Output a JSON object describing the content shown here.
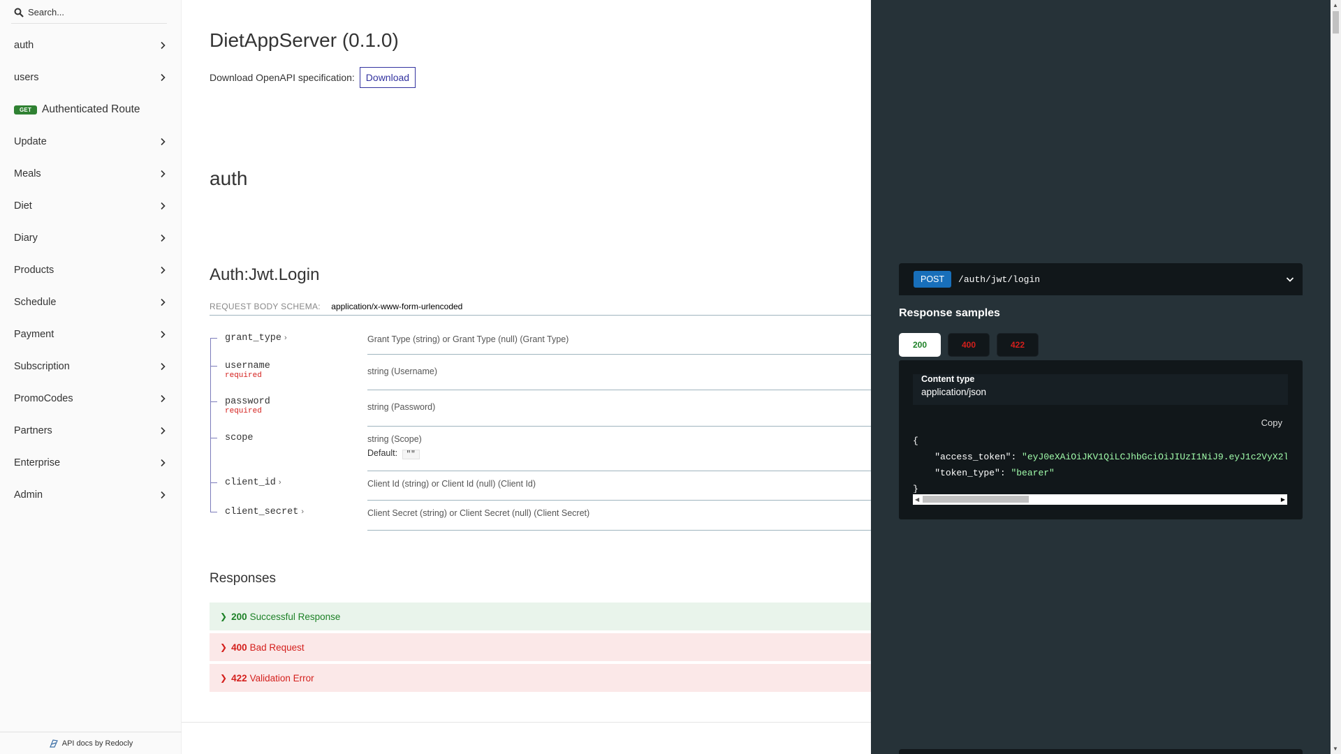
{
  "sidebar": {
    "search_placeholder": "Search...",
    "items": [
      {
        "label": "auth"
      },
      {
        "label": "users"
      },
      {
        "label": "Authenticated Route",
        "badge": "GET"
      },
      {
        "label": "Update"
      },
      {
        "label": "Meals"
      },
      {
        "label": "Diet"
      },
      {
        "label": "Diary"
      },
      {
        "label": "Products"
      },
      {
        "label": "Schedule"
      },
      {
        "label": "Payment"
      },
      {
        "label": "Subscription"
      },
      {
        "label": "PromoCodes"
      },
      {
        "label": "Partners"
      },
      {
        "label": "Enterprise"
      },
      {
        "label": "Admin"
      }
    ],
    "powered_by": "API docs by Redocly"
  },
  "main": {
    "api_title": "DietAppServer (0.1.0)",
    "download_label": "Download OpenAPI specification:",
    "download_button": "Download",
    "tag_title": "auth",
    "operation_title": "Auth:Jwt.Login",
    "schema_label": "REQUEST BODY SCHEMA:",
    "schema_type": "application/x-www-form-urlencoded",
    "params": [
      {
        "name": "grant_type",
        "desc": "Grant Type (string) or Grant Type (null) (Grant Type)",
        "expandable": "›"
      },
      {
        "name": "username",
        "required": "required",
        "desc": "string (Username)"
      },
      {
        "name": "password",
        "required": "required",
        "desc": "string (Password)"
      },
      {
        "name": "scope",
        "desc": "string (Scope)",
        "default_label": "Default:",
        "default_value": "\"\""
      },
      {
        "name": "client_id",
        "desc": "Client Id (string) or Client Id (null) (Client Id)",
        "expandable": "›"
      },
      {
        "name": "client_secret",
        "desc": "Client Secret (string) or Client Secret (null) (Client Secret)",
        "expandable": "›"
      }
    ],
    "responses_title": "Responses",
    "responses": [
      {
        "code": "200",
        "text": "Successful Response"
      },
      {
        "code": "400",
        "text": "Bad Request"
      },
      {
        "code": "422",
        "text": "Validation Error"
      }
    ]
  },
  "right": {
    "method": "POST",
    "path": "/auth/jwt/login",
    "samples_title": "Response samples",
    "tabs": [
      "200",
      "400",
      "422"
    ],
    "content_type_label": "Content type",
    "content_type": "application/json",
    "copy": "Copy",
    "code": {
      "open": "{",
      "key1": "\"access_token\"",
      "val1": "\"eyJ0eXAiOiJKV1QiLCJhbGciOiJIUzI1NiJ9.eyJ1c2VyX2l",
      "key2": "\"token_type\"",
      "val2": "\"bearer\"",
      "close": "}"
    }
  },
  "colors": {
    "get_badge": "#2f8132",
    "post_badge": "#186fba",
    "success": "#1d8127",
    "error": "#d41f1c",
    "right_panel": "#263238",
    "link": "#32329f"
  }
}
